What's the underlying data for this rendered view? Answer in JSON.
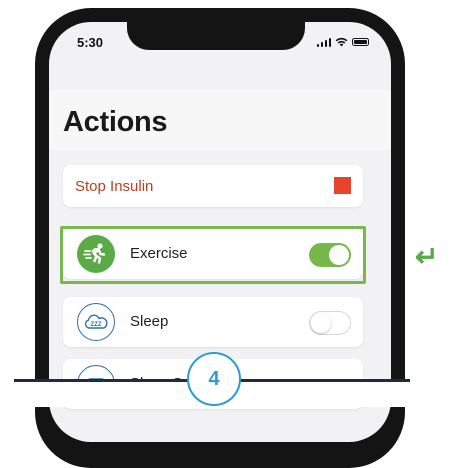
{
  "status_bar": {
    "time": "5:30"
  },
  "page": {
    "title": "Actions"
  },
  "stop_insulin": {
    "label": "Stop Insulin",
    "indicator_color": "#e8442c"
  },
  "actions": [
    {
      "label": "Exercise",
      "icon": "runner-icon",
      "toggle_on": true
    },
    {
      "label": "Sleep",
      "icon": "zzz-cloud-icon",
      "toggle_on": false
    },
    {
      "label": "Sleep S",
      "icon": "sleep-schedule-icon"
    }
  ],
  "callout": {
    "step": "4",
    "arrow_icon": "return-arrow-icon"
  },
  "colors": {
    "highlight": "#79b84c",
    "exercise_icon_bg": "#5aab46",
    "toggle_on": "#76b84a",
    "sleep_icon_stroke": "#2a6fb2",
    "badge": "#2f9bd6",
    "stop_text": "#b8401e"
  }
}
